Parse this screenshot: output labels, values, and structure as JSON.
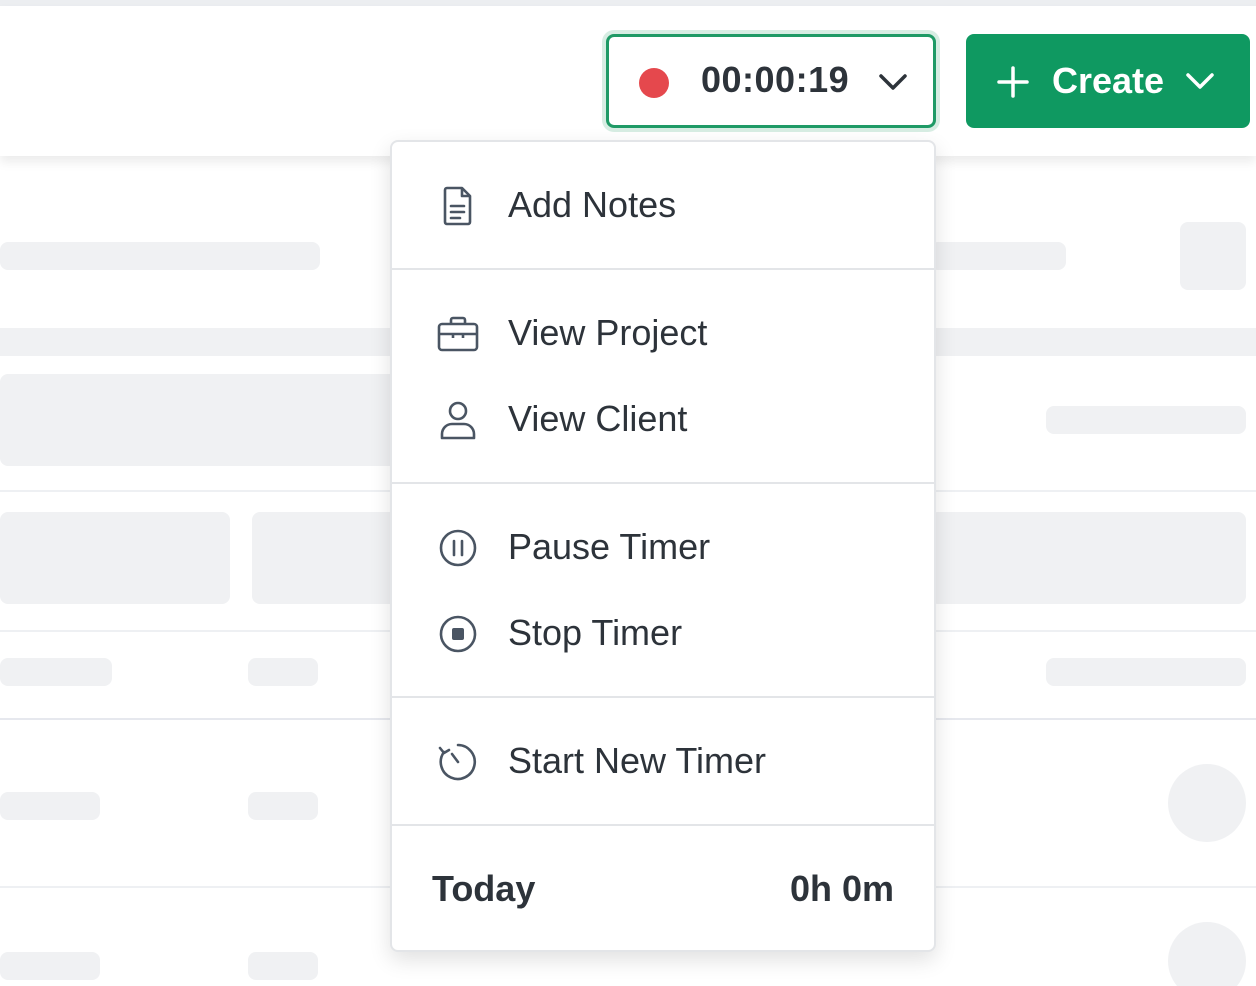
{
  "header": {
    "timer": {
      "elapsed": "00:00:19",
      "status_color": "#e5484d",
      "border_color": "#1f9a66",
      "icon": "chevron-down-icon"
    },
    "create_button": {
      "label": "Create",
      "color": "#0f9961",
      "icons": [
        "plus-icon",
        "chevron-down-icon"
      ]
    }
  },
  "menu": {
    "items": [
      {
        "label": "Add Notes",
        "icon": "document-icon"
      },
      {
        "label": "View Project",
        "icon": "briefcase-icon"
      },
      {
        "label": "View Client",
        "icon": "user-icon"
      },
      {
        "label": "Pause Timer",
        "icon": "pause-circle-icon"
      },
      {
        "label": "Stop Timer",
        "icon": "stop-circle-icon"
      },
      {
        "label": "Start New Timer",
        "icon": "timer-restart-icon"
      }
    ],
    "summary": {
      "label": "Today",
      "value": "0h 0m"
    }
  }
}
